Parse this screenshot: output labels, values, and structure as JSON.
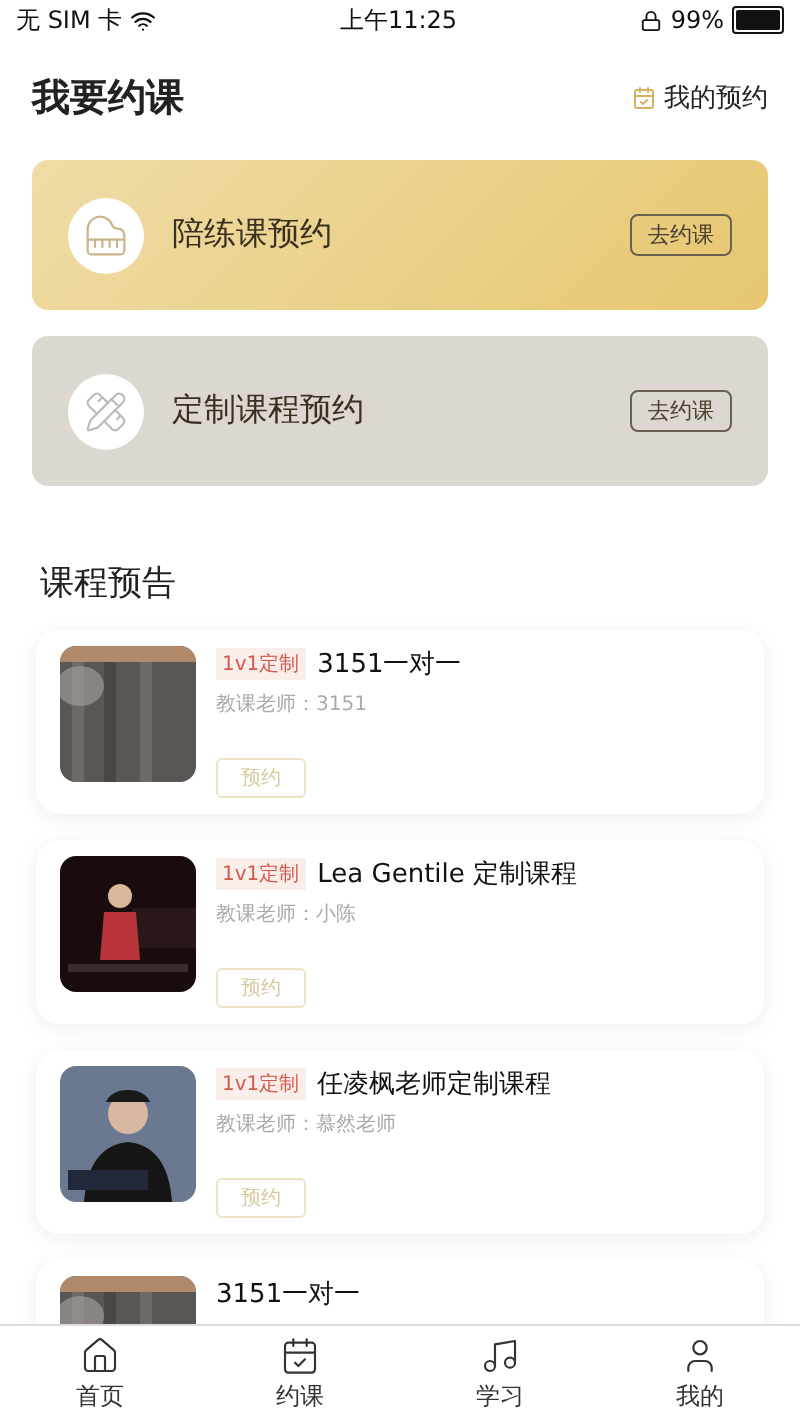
{
  "status_bar": {
    "carrier": "无 SIM 卡",
    "time": "上午11:25",
    "battery": "99%"
  },
  "header": {
    "title": "我要约课",
    "link": "我的预约"
  },
  "booking_cards": [
    {
      "kind": "piano",
      "title": "陪练课预约",
      "button": "去约课"
    },
    {
      "kind": "tools",
      "title": "定制课程预约",
      "button": "去约课"
    }
  ],
  "section_title": "课程预告",
  "courses": [
    {
      "tag": "1v1定制",
      "title": "3151一对一",
      "teacher": "教课老师：3151",
      "button": "预约"
    },
    {
      "tag": "1v1定制",
      "title": "Lea Gentile 定制课程",
      "teacher": "教课老师：小陈",
      "button": "预约"
    },
    {
      "tag": "1v1定制",
      "title": "任凌枫老师定制课程",
      "teacher": "教课老师：慕然老师",
      "button": "预约"
    },
    {
      "title": "3151一对一"
    }
  ],
  "tabs": [
    {
      "label": "首页"
    },
    {
      "label": "约课"
    },
    {
      "label": "学习"
    },
    {
      "label": "我的"
    }
  ]
}
